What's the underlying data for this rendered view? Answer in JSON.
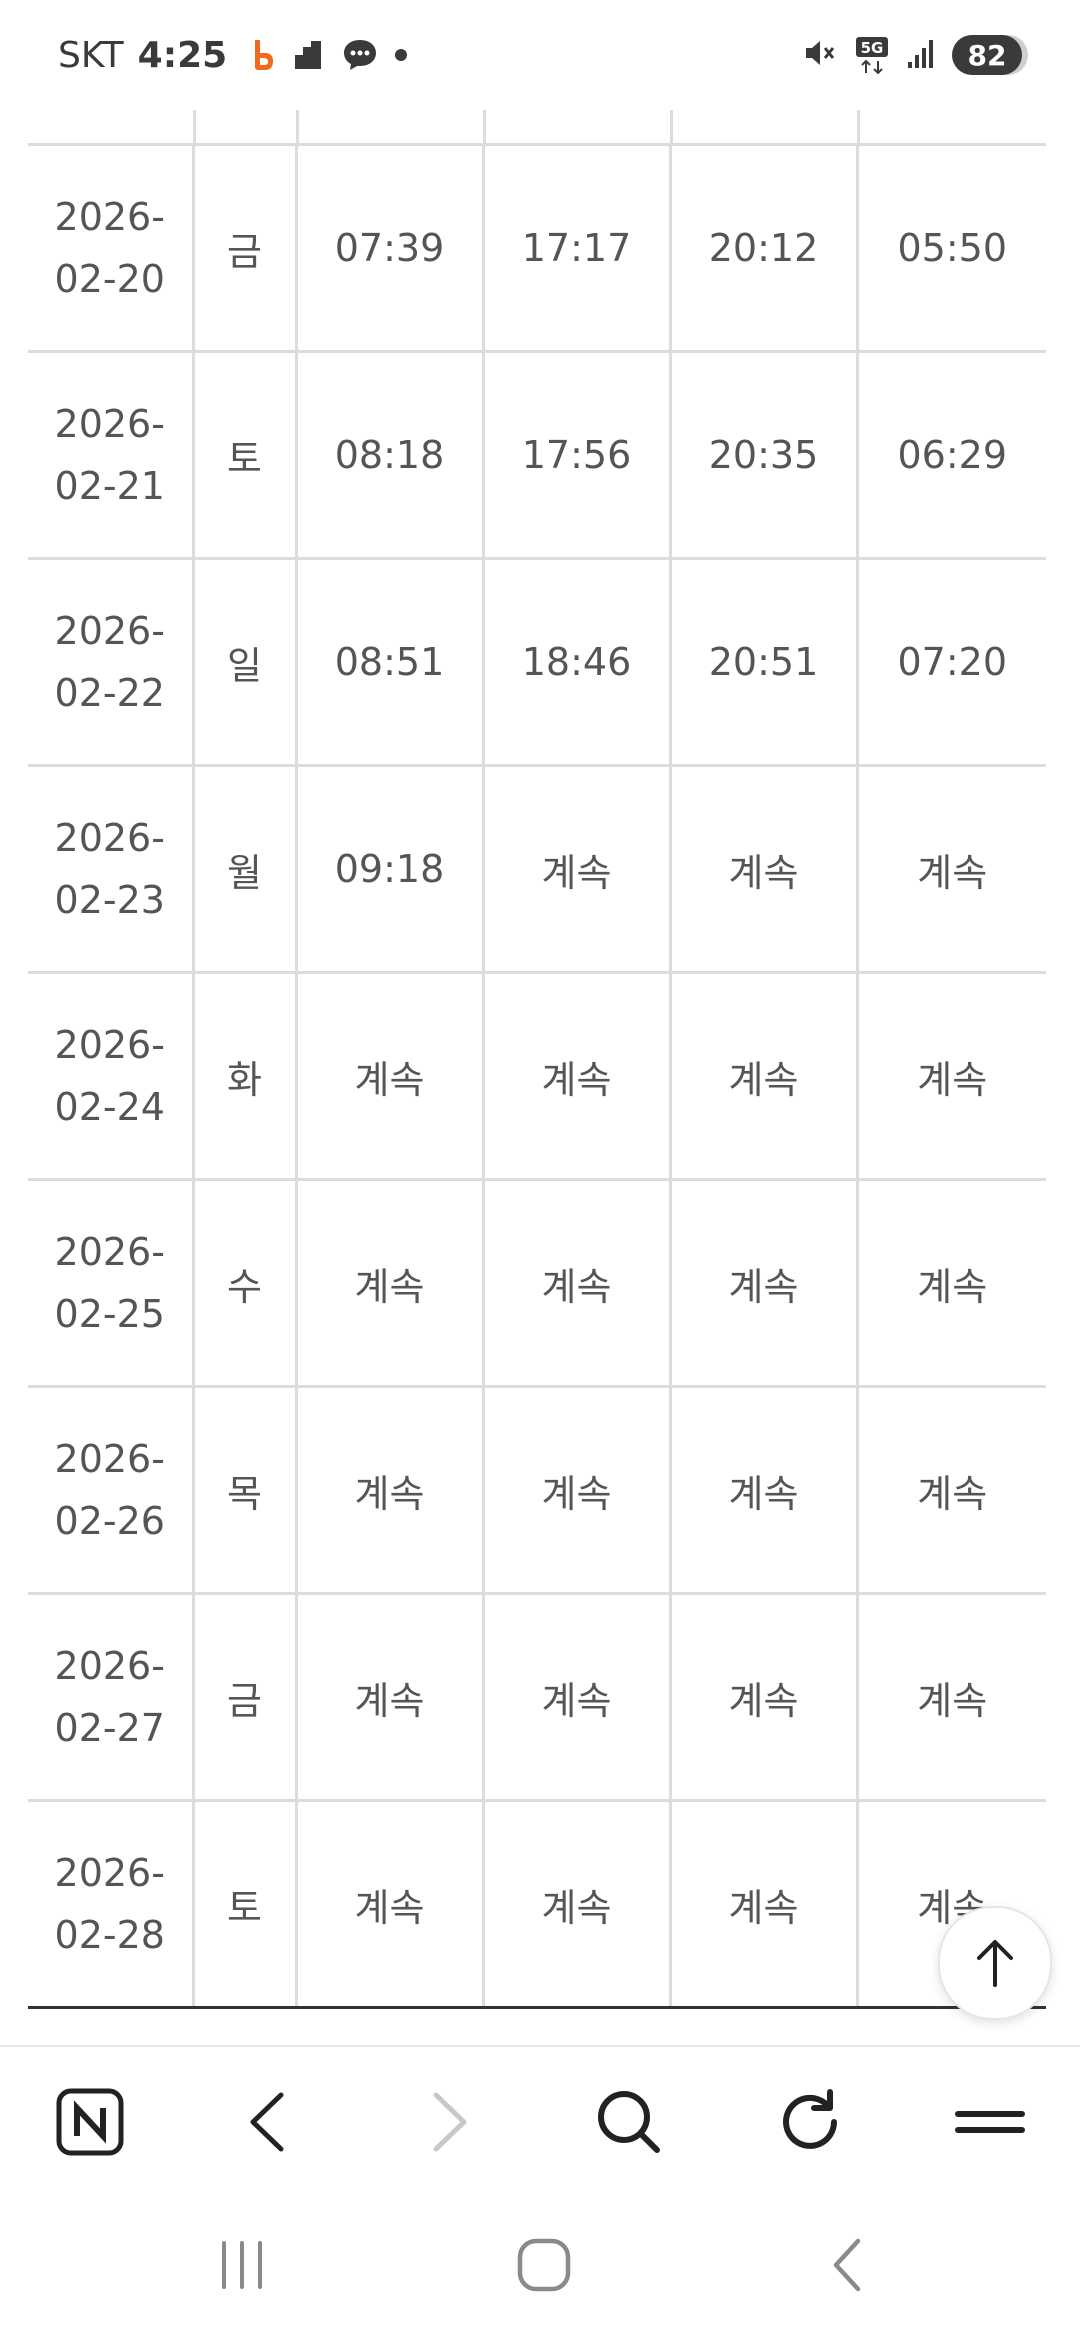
{
  "status_bar": {
    "carrier": "SKT",
    "time": "4:25",
    "network": "5G",
    "battery": "82",
    "left_icons": [
      "b-app-icon",
      "cloud-app-icon",
      "chat-bubble-icon",
      "dot-icon"
    ],
    "right_icons": [
      "mute-icon",
      "5g-icon",
      "signal-icon",
      "battery-icon"
    ]
  },
  "table": {
    "rows": [
      {
        "date": "2026-02-20",
        "day": "금",
        "c1": "07:39",
        "c2": "17:17",
        "c3": "20:12",
        "c4": "05:50"
      },
      {
        "date": "2026-02-21",
        "day": "토",
        "c1": "08:18",
        "c2": "17:56",
        "c3": "20:35",
        "c4": "06:29"
      },
      {
        "date": "2026-02-22",
        "day": "일",
        "c1": "08:51",
        "c2": "18:46",
        "c3": "20:51",
        "c4": "07:20"
      },
      {
        "date": "2026-02-23",
        "day": "월",
        "c1": "09:18",
        "c2": "계속",
        "c3": "계속",
        "c4": "계속"
      },
      {
        "date": "2026-02-24",
        "day": "화",
        "c1": "계속",
        "c2": "계속",
        "c3": "계속",
        "c4": "계속"
      },
      {
        "date": "2026-02-25",
        "day": "수",
        "c1": "계속",
        "c2": "계속",
        "c3": "계속",
        "c4": "계속"
      },
      {
        "date": "2026-02-26",
        "day": "목",
        "c1": "계속",
        "c2": "계속",
        "c3": "계속",
        "c4": "계속"
      },
      {
        "date": "2026-02-27",
        "day": "금",
        "c1": "계속",
        "c2": "계속",
        "c3": "계속",
        "c4": "계속"
      },
      {
        "date": "2026-02-28",
        "day": "토",
        "c1": "계속",
        "c2": "계속",
        "c3": "계속",
        "c4": "계속"
      }
    ]
  },
  "floating": {
    "scroll_top_icon": "arrow-up-icon"
  },
  "toolbar": {
    "items": [
      "naver-home-icon",
      "back-icon",
      "forward-icon",
      "search-icon",
      "refresh-icon",
      "menu-icon"
    ],
    "forward_enabled": false
  },
  "system_nav": {
    "items": [
      "recent-apps-icon",
      "home-icon",
      "back-icon"
    ]
  },
  "colors": {
    "text": "#555555",
    "grid": "#dcdcdc",
    "table_bottom": "#333333",
    "battery_bg": "#3a3a3a",
    "accent_app": "#f26b1d"
  }
}
